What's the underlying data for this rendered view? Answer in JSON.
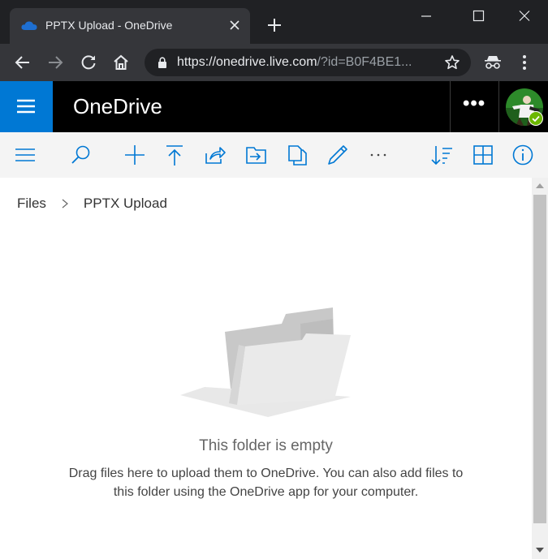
{
  "tab": {
    "title": "PPTX Upload - OneDrive",
    "favicon": "onedrive-cloud-icon",
    "close": "close-icon"
  },
  "window": {
    "minimize": "minimize-icon",
    "maximize": "maximize-icon",
    "close": "close-icon"
  },
  "omnibox": {
    "url_host": "https://onedrive.live.com",
    "url_rest": "/?id=B0F4BE1..."
  },
  "header": {
    "brand": "OneDrive",
    "more": "•••"
  },
  "commands": [
    "menu-icon",
    "search-icon",
    "add-icon",
    "upload-icon",
    "share-icon",
    "move-to-icon",
    "copy-to-icon",
    "rename-icon",
    "more-icon",
    "sort-icon",
    "view-icon",
    "info-icon"
  ],
  "breadcrumb": {
    "root": "Files",
    "current": "PPTX Upload"
  },
  "empty": {
    "title": "This folder is empty",
    "description": "Drag files here to upload them to OneDrive. You can also add files to this folder using the OneDrive app for your computer."
  },
  "colors": {
    "accent": "#0078d4",
    "header_bg": "#000000",
    "chrome_bg": "#202124",
    "toolbar_bg": "#35363a"
  }
}
